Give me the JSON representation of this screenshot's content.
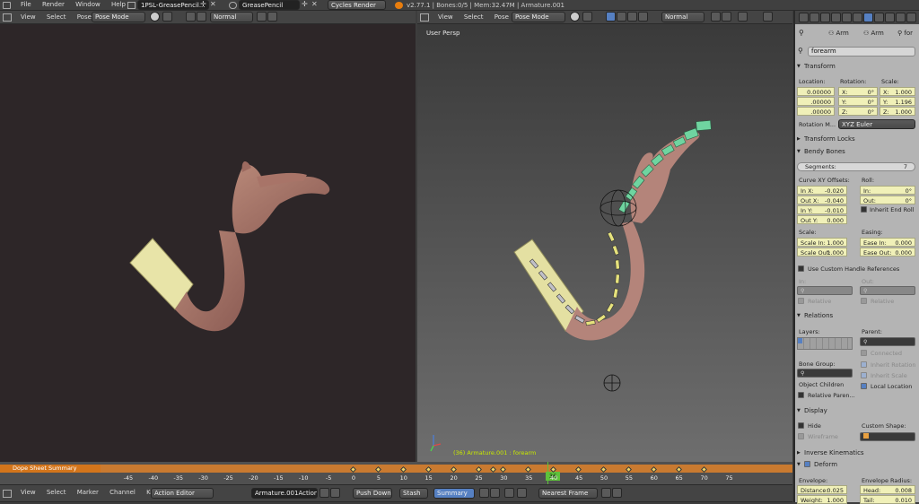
{
  "topbar": {
    "menus": [
      "File",
      "Render",
      "Window",
      "Help"
    ],
    "screen_name": "1PSL-GreasePencil...",
    "scene_name": "GreasePencil",
    "render_engine": "Cycles Render",
    "stats": "v2.77.1 | Bones:0/5 | Mem:32.47M | Armature.001"
  },
  "viewport_left": {
    "menus": [
      "View",
      "Select",
      "Pose"
    ],
    "mode": "Pose Mode",
    "pivot": "Normal"
  },
  "viewport_right": {
    "menus": [
      "View",
      "Select",
      "Pose"
    ],
    "mode": "Pose Mode",
    "pivot": "Normal",
    "label": "User Persp",
    "status": "(36) Armature.001 : forearm"
  },
  "properties": {
    "breadcrumb": [
      "Arm",
      "Arm",
      "for"
    ],
    "bone_name": "forearm",
    "transform": {
      "title": "Transform",
      "location_label": "Location:",
      "rotation_label": "Rotation:",
      "scale_label": "Scale:",
      "location": [
        "0.00000",
        ".00000",
        ".00000"
      ],
      "rotation": [
        {
          "k": "X:",
          "v": "0°"
        },
        {
          "k": "Y:",
          "v": "0°"
        },
        {
          "k": "Z:",
          "v": "0°"
        }
      ],
      "scale": [
        {
          "k": "X:",
          "v": "1.000"
        },
        {
          "k": "Y:",
          "v": "1.196"
        },
        {
          "k": "Z:",
          "v": "1.000"
        }
      ],
      "rotation_mode_label": "Rotation M...",
      "rotation_mode": "XYZ Euler"
    },
    "transform_locks": "Transform Locks",
    "bendy": {
      "title": "Bendy Bones",
      "segments_label": "Segments:",
      "segments": "7",
      "curve_label": "Curve XY Offsets:",
      "roll_label": "Roll:",
      "in_x": {
        "k": "In X:",
        "v": "-0.020"
      },
      "out_x": {
        "k": "Out X:",
        "v": "-0.040"
      },
      "in_y": {
        "k": "In Y:",
        "v": "-0.010"
      },
      "out_y": {
        "k": "Out Y:",
        "v": "0.000"
      },
      "roll_in": {
        "k": "In:",
        "v": "0°"
      },
      "roll_out": {
        "k": "Out:",
        "v": "0°"
      },
      "inherit_end_roll": "Inherit End Roll",
      "scale_label": "Scale:",
      "easing_label": "Easing:",
      "scale_in": {
        "k": "Scale In:",
        "v": "1.000"
      },
      "scale_out": {
        "k": "Scale Out:",
        "v": "1.000"
      },
      "ease_in": {
        "k": "Ease In:",
        "v": "0.000"
      },
      "ease_out": {
        "k": "Ease Out:",
        "v": "0.000"
      },
      "use_custom_handle": "Use Custom Handle References",
      "in_label": "In:",
      "out_label": "Out:",
      "relative": "Relative"
    },
    "relations": {
      "title": "Relations",
      "layers_label": "Layers:",
      "parent_label": "Parent:",
      "connected": "Connected",
      "bone_group_label": "Bone Group:",
      "inherit_rotation": "Inherit Rotation",
      "inherit_scale": "Inherit Scale",
      "object_children": "Object Children",
      "local_location": "Local Location",
      "relative_parent": "Relative Paren..."
    },
    "display": {
      "title": "Display",
      "hide": "Hide",
      "custom_shape_label": "Custom Shape:",
      "wireframe": "Wireframe"
    },
    "inverse_kinematics": "Inverse Kinematics",
    "deform": {
      "title": "Deform",
      "envelope_label": "Envelope:",
      "envelope_radius_label": "Envelope Radius:",
      "distance": {
        "k": "Distance:",
        "v": "0.025"
      },
      "weight": {
        "k": "Weight:",
        "v": "1.000"
      },
      "head": {
        "k": "Head:",
        "v": "0.008"
      },
      "tail": {
        "k": "Tail:",
        "v": "0.010"
      }
    }
  },
  "timeline": {
    "summary_label": "Dope Sheet Summary",
    "ticks": [
      "-45",
      "-40",
      "-35",
      "-30",
      "-25",
      "-20",
      "-15",
      "-10",
      "-5",
      "0",
      "5",
      "10",
      "15",
      "20",
      "25",
      "30",
      "35",
      "40",
      "45",
      "50",
      "55",
      "60",
      "65",
      "70",
      "75"
    ],
    "current_frame": "36",
    "keyframes": [
      0,
      5,
      10,
      15,
      20,
      25,
      28,
      30,
      35,
      40,
      45,
      50,
      55,
      60,
      65,
      70
    ]
  },
  "bottombar": {
    "menus": [
      "View",
      "Select",
      "Marker",
      "Channel",
      "Key"
    ],
    "editor": "Action Editor",
    "action": "Armature.001Action",
    "push_down": "Push Down",
    "stash": "Stash",
    "summary": "Summary",
    "snap": "Nearest Frame"
  },
  "colors": {
    "accent": "#5680c2",
    "timeline_orange": "#d3751b",
    "bone_selected": "#6fd4a0",
    "bone_yellow": "#e6e27c"
  }
}
